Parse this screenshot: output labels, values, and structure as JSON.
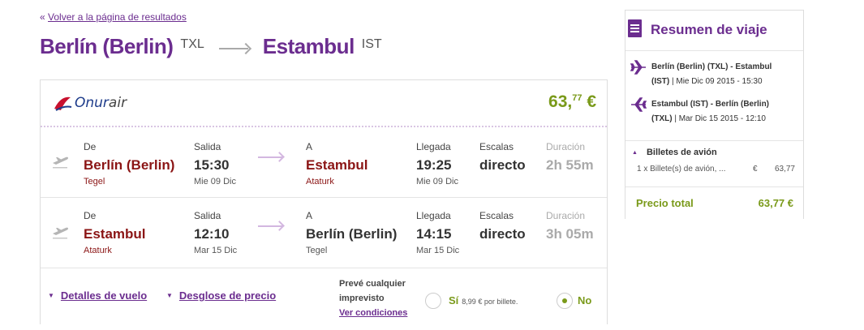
{
  "back_link": {
    "arrow": "«",
    "label": "Volver a la página de resultados"
  },
  "route": {
    "origin_city": "Berlín (Berlin)",
    "origin_code": "TXL",
    "destination_city": "Estambul",
    "destination_code": "IST"
  },
  "flight": {
    "airline": {
      "name_main": "Onur",
      "name_suffix": "air"
    },
    "price": {
      "whole": "63,",
      "cents": "77",
      "currency": "€"
    },
    "headers": {
      "from": "De",
      "departure": "Salida",
      "to": "A",
      "arrival": "Llegada",
      "stops": "Escalas",
      "duration": "Duración"
    },
    "legs": [
      {
        "from_city": "Berlín (Berlin)",
        "from_airport": "Tegel",
        "dep_time": "15:30",
        "dep_date": "Mie 09 Dic",
        "to_city": "Estambul",
        "to_airport": "Ataturk",
        "arr_time": "19:25",
        "arr_date": "Mie 09 Dic",
        "stops": "directo",
        "duration": "2h 55m"
      },
      {
        "from_city": "Estambul",
        "from_airport": "Ataturk",
        "dep_time": "12:10",
        "dep_date": "Mar 15 Dic",
        "to_city": "Berlín (Berlin)",
        "to_airport": "Tegel",
        "arr_time": "14:15",
        "arr_date": "Mar 15 Dic",
        "stops": "directo",
        "duration": "3h 05m"
      }
    ],
    "links": {
      "details": "Detalles de vuelo",
      "breakdown": "Desglose de precio"
    },
    "insurance": {
      "line1": "Prevé cualquier",
      "line2": "imprevisto",
      "conditions": "Ver condiciones",
      "yes_label": "Sí",
      "yes_note": "8,99 € por billete.",
      "no_label": "No",
      "selected": "no"
    }
  },
  "summary": {
    "title": "Resumen de viaje",
    "flights": [
      {
        "route_a": "Berlín (Berlin) (TXL) - Estambul",
        "route_b": "(IST)",
        "date": "Mie Dic 09 2015 - 15:30"
      },
      {
        "route_a": "Estambul (IST) - Berlín (Berlin)",
        "route_b": "(TXL)",
        "date": "Mar Dic 15 2015 - 12:10"
      }
    ],
    "tickets_header": "Billetes de avión",
    "ticket_line": "1 x Billete(s) de avión, ...",
    "ticket_currency": "€",
    "ticket_amount": "63,77",
    "total_label": "Precio total",
    "total_value": "63,77 €"
  },
  "colors": {
    "brand_purple": "#6b2d8f",
    "price_green": "#7a9a1a",
    "city_red": "#8b1515"
  }
}
